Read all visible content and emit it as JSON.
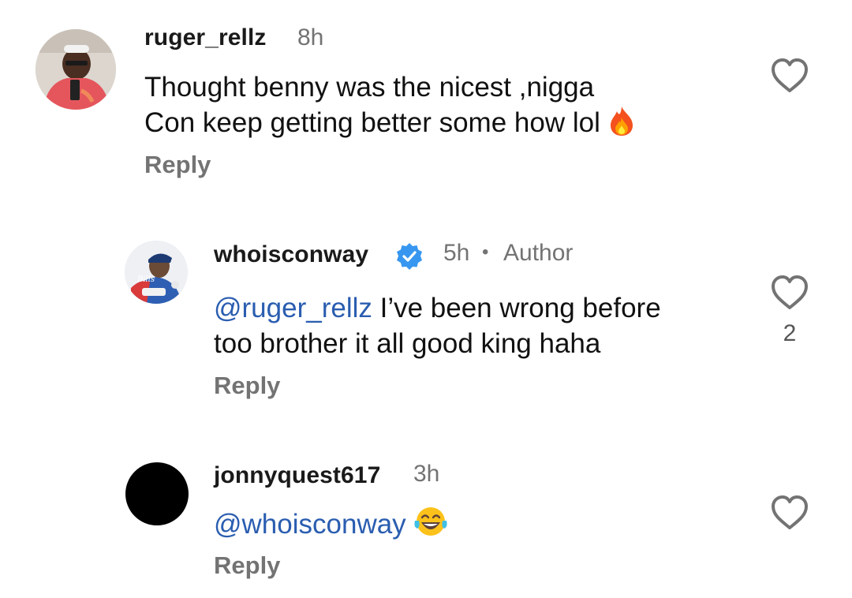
{
  "comments": [
    {
      "username": "ruger_rellz",
      "time": "8h",
      "line1": "Thought benny was the nicest ,nigga",
      "line2": "Con keep getting better some how lol",
      "emoji": "fire-emoji",
      "reply_label": "Reply"
    },
    {
      "username": "whoisconway",
      "verified": true,
      "time": "5h",
      "separator": "•",
      "author_badge": "Author",
      "mention": "@ruger_rellz",
      "line1_rest": " I’ve been wrong before",
      "line2": "too brother it all good king haha",
      "reply_label": "Reply",
      "like_count": "2"
    },
    {
      "username": "jonnyquest617",
      "time": "3h",
      "mention": "@whoisconway",
      "emoji": "tears-of-joy-emoji",
      "reply_label": "Reply"
    }
  ],
  "colors": {
    "mention": "#2a5db0",
    "muted": "#737373",
    "verified_blue": "#3797f0",
    "text": "#111111"
  }
}
